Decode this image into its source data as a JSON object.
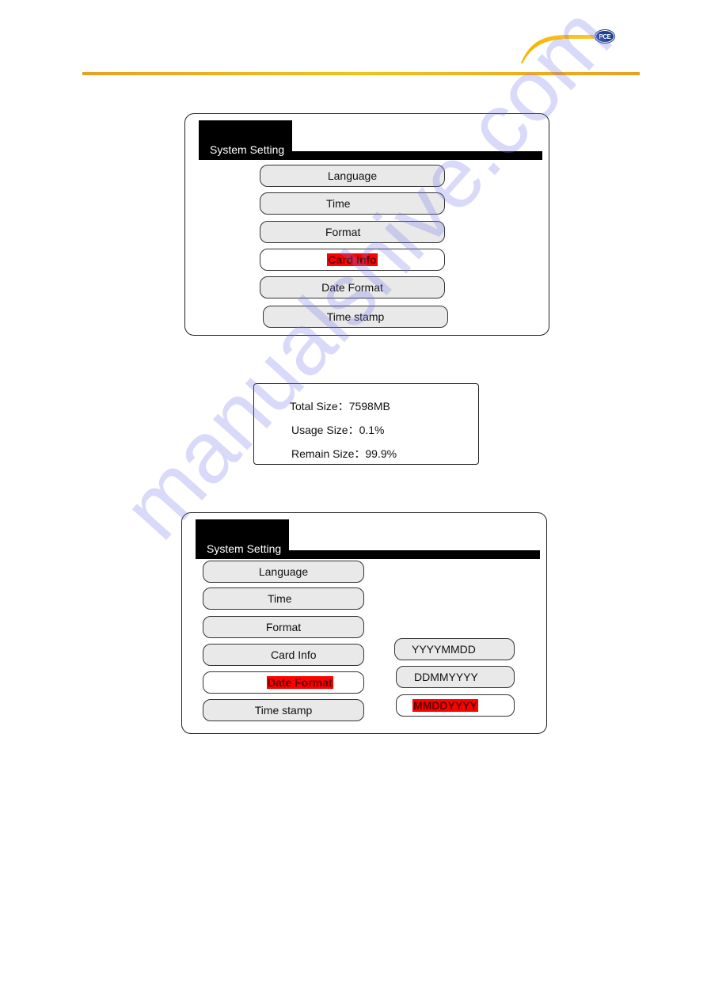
{
  "header": {
    "brand_logo_text": "PCE",
    "accent_color": "#f3c21a"
  },
  "panel1": {
    "title": "System Setting",
    "menu": [
      {
        "label": "Language",
        "selected": false
      },
      {
        "label": "Time",
        "selected": false
      },
      {
        "label": "Format",
        "selected": false
      },
      {
        "label": "Card Info",
        "selected": true
      },
      {
        "label": "Date Format",
        "selected": false
      },
      {
        "label": "Time stamp",
        "selected": false
      }
    ]
  },
  "card_info": {
    "rows": [
      {
        "label": "Total Size",
        "separator": "：",
        "value": "7598MB"
      },
      {
        "label": "Usage Size",
        "separator": "：",
        "value": "0.1%"
      },
      {
        "label": "Remain Size",
        "separator": "：",
        "value": "99.9%"
      }
    ]
  },
  "panel2": {
    "title": "System Setting",
    "menu": [
      {
        "label": "Language",
        "selected": false
      },
      {
        "label": "Time",
        "selected": false
      },
      {
        "label": "Format",
        "selected": false
      },
      {
        "label": "Card Info",
        "selected": false
      },
      {
        "label": "Date Format",
        "selected": true
      },
      {
        "label": "Time stamp",
        "selected": false
      }
    ],
    "date_format_options": [
      {
        "label": "YYYYMMDD",
        "selected": false
      },
      {
        "label": "DDMMYYYY",
        "selected": false
      },
      {
        "label": "MMDDYYYY",
        "selected": true
      }
    ]
  },
  "highlight_color": "#ff0000",
  "watermark": "manualshive.com"
}
